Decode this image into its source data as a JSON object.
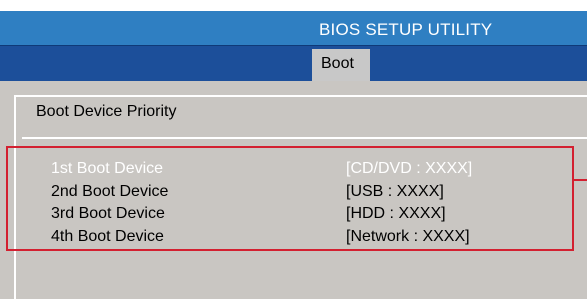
{
  "header": {
    "title": "BIOS  SETUP  UTILITY"
  },
  "tabs": [
    {
      "label": "Boot"
    }
  ],
  "section": {
    "title": "Boot Device Priority"
  },
  "boot_devices": [
    {
      "label": "1st Boot Device",
      "value": "[CD/DVD : XXXX]",
      "selected": true
    },
    {
      "label": "2nd Boot Device",
      "value": "[USB : XXXX]",
      "selected": false
    },
    {
      "label": "3rd Boot Device",
      "value": "[HDD : XXXX]",
      "selected": false
    },
    {
      "label": "4th Boot Device",
      "value": "[Network : XXXX]",
      "selected": false
    }
  ],
  "colors": {
    "title_bar": "#2f7fc2",
    "tab_bar": "#1c4f9a",
    "panel": "#c9c6c2",
    "highlight": "#d32030",
    "selected_text": "#ffffff"
  }
}
